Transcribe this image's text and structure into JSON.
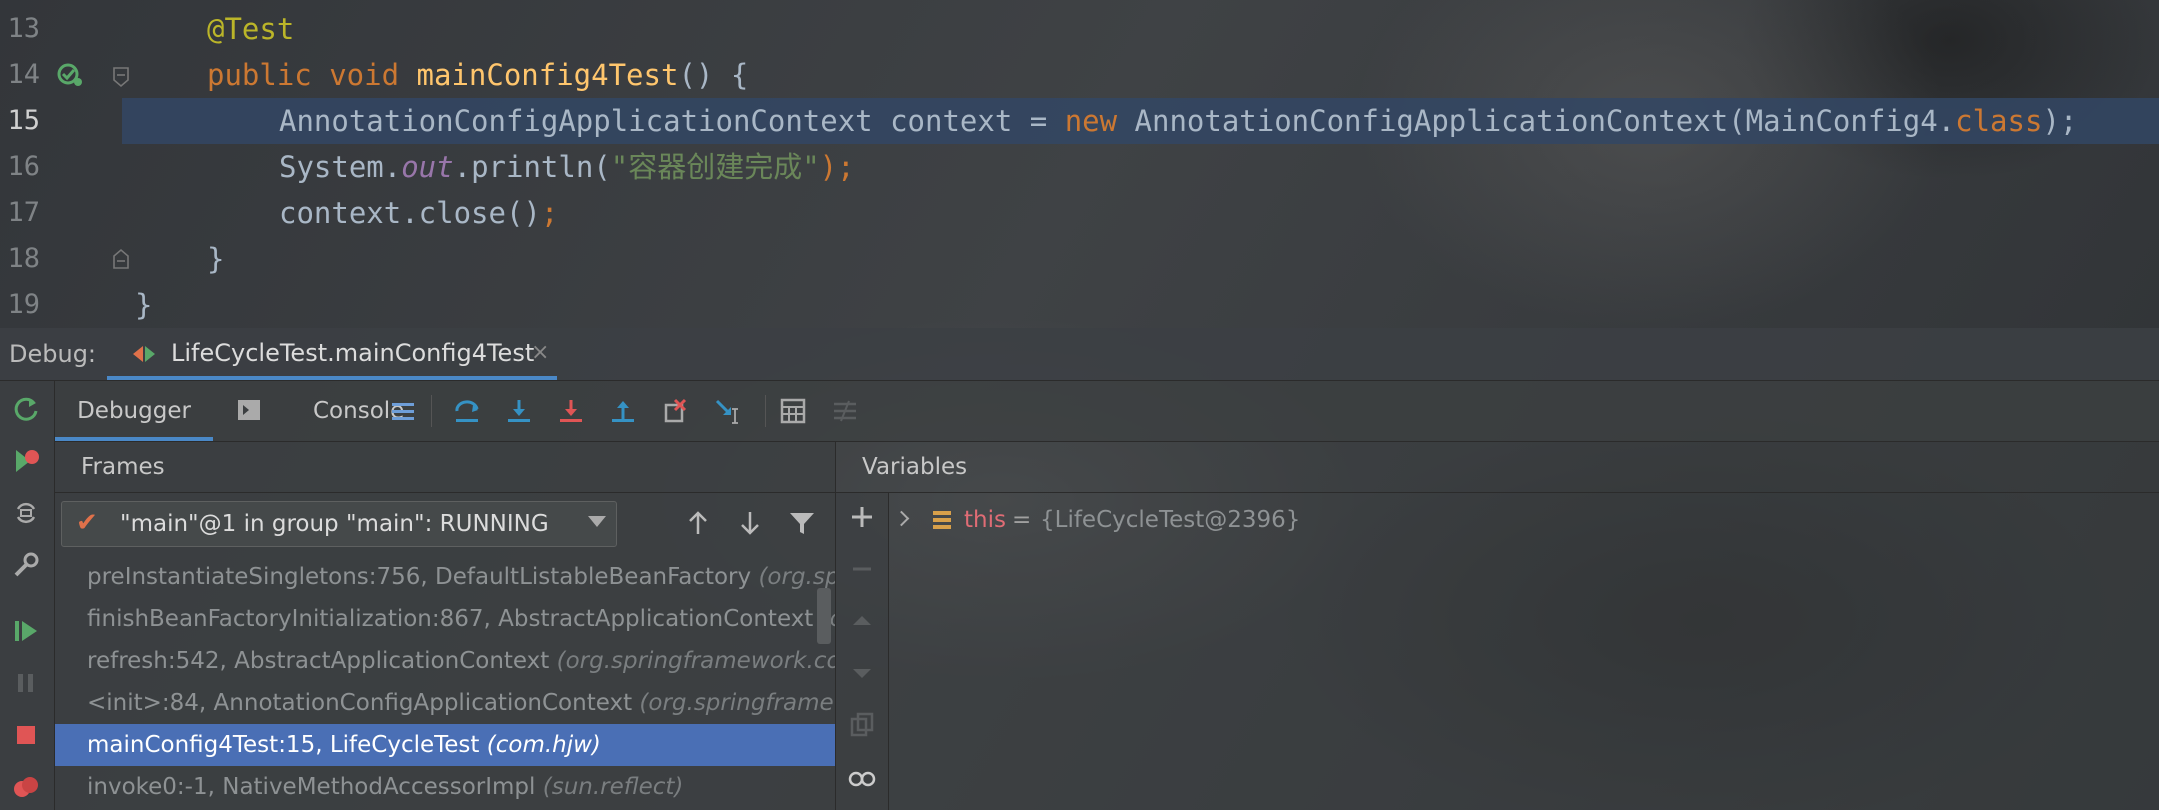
{
  "editor": {
    "lines": [
      {
        "num": "13",
        "tokens": [
          {
            "t": "@Test",
            "c": "ann"
          }
        ]
      },
      {
        "num": "14",
        "tokens": [
          {
            "t": "public ",
            "c": "kw"
          },
          {
            "t": "void ",
            "c": "kw"
          },
          {
            "t": "mainConfig4Test",
            "c": "fn"
          },
          {
            "t": "() {",
            "c": "plain"
          }
        ]
      },
      {
        "num": "15",
        "tokens": [
          {
            "t": "AnnotationConfigApplicationContext context = ",
            "c": "plain"
          },
          {
            "t": "new ",
            "c": "kw"
          },
          {
            "t": "AnnotationConfigApplicationContext(MainConfig4.",
            "c": "plain"
          },
          {
            "t": "class",
            "c": "kw"
          },
          {
            "t": ");",
            "c": "plain"
          }
        ]
      },
      {
        "num": "16",
        "tokens": [
          {
            "t": "System.",
            "c": "plain"
          },
          {
            "t": "out",
            "c": "fld"
          },
          {
            "t": ".println(",
            "c": "plain"
          },
          {
            "t": "\"容器创建完成\"",
            "c": "str"
          },
          {
            "t": ");",
            "c": "kw"
          }
        ]
      },
      {
        "num": "17",
        "tokens": [
          {
            "t": "context.close()",
            "c": "plain"
          },
          {
            "t": ";",
            "c": "kw"
          }
        ]
      },
      {
        "num": "18",
        "tokens": [
          {
            "t": "}",
            "c": "plain"
          }
        ]
      },
      {
        "num": "19",
        "tokens": [
          {
            "t": "}",
            "c": "plain"
          }
        ]
      }
    ],
    "current_line": "15"
  },
  "debug": {
    "label": "Debug:",
    "session_tab": "LifeCycleTest.mainConfig4Test",
    "close_glyph": "×"
  },
  "toolbar": {
    "debugger_tab": "Debugger",
    "console_tab": "Console"
  },
  "frames": {
    "title": "Frames",
    "thread": "\"main\"@1 in group \"main\": RUNNING",
    "rows": [
      {
        "name": "preInstantiateSingletons:756, DefaultListableBeanFactory ",
        "pkg": "(org.springframework.beans.factory.support)",
        "selected": false
      },
      {
        "name": "finishBeanFactoryInitialization:867, AbstractApplicationContext ",
        "pkg": "(org.springframework.context.support)",
        "selected": false
      },
      {
        "name": "refresh:542, AbstractApplicationContext ",
        "pkg": "(org.springframework.context.support)",
        "selected": false
      },
      {
        "name": "<init>:84, AnnotationConfigApplicationContext ",
        "pkg": "(org.springframework.context.annotation)",
        "selected": false
      },
      {
        "name": "mainConfig4Test:15, LifeCycleTest ",
        "pkg": "(com.hjw)",
        "selected": true
      },
      {
        "name": "invoke0:-1, NativeMethodAccessorImpl ",
        "pkg": "(sun.reflect)",
        "selected": false
      }
    ]
  },
  "variables": {
    "title": "Variables",
    "items": [
      {
        "name": "this",
        "eq": "=",
        "value": "{LifeCycleTest@2396}"
      }
    ]
  }
}
